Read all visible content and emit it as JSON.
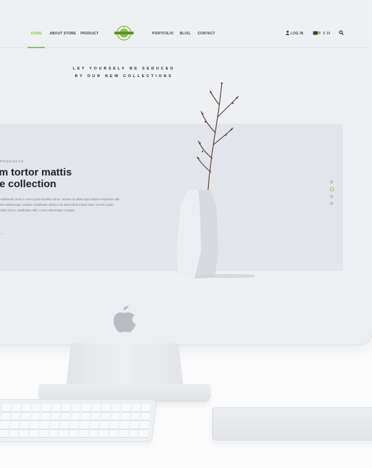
{
  "nav": {
    "items": [
      {
        "label": "HOME",
        "active": true
      },
      {
        "label": "ABOUT STORE",
        "active": false
      },
      {
        "label": "PRODUCT",
        "active": false
      },
      {
        "label": "PORTFOLIO",
        "active": false
      },
      {
        "label": "BLOG",
        "active": false
      },
      {
        "label": "CONTACT",
        "active": false
      }
    ],
    "login_label": "LOG IN",
    "cart_total": "$ 30",
    "accent": "#8bc34a"
  },
  "hero": {
    "headline_line1": "LET YOURSELF BE SEDUCED",
    "headline_line2": "BY OUR NEW COLLECTIONS",
    "kicker": "PRODUCTS",
    "title_line1": "am tortor mattis",
    "title_line2": "ne collection",
    "body": "m sollicitudin. Nunc in eros a justo facilisis rutrum. Aenean id ullamcorper tibulum imperdiet nibh. Lorem ullamcorper volutpat. Vestibulum lacinia e sit amet tellus mauris Nunc in eros a justo facilisis rutrum. Vestibulum nibh. Lorem ullamcorper volutpat.",
    "cta_arrow": "→",
    "slides": 4,
    "active_slide": 2
  }
}
